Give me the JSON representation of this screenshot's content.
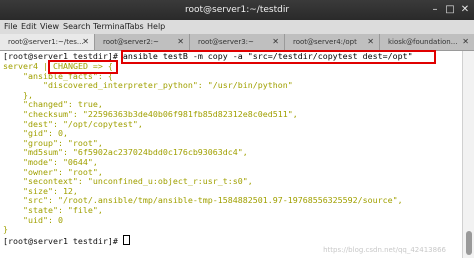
{
  "window": {
    "title": "root@server1:~/testdir",
    "menu": [
      "File",
      "Edit",
      "View",
      "Search",
      "Terminal",
      "Tabs",
      "Help"
    ],
    "tabs": [
      {
        "label": "root@server1:~/tes...",
        "active": true
      },
      {
        "label": "root@server2:~",
        "active": false
      },
      {
        "label": "root@server3:~",
        "active": false
      },
      {
        "label": "root@server4:/opt",
        "active": false
      },
      {
        "label": "kiosk@foundation...",
        "active": false
      }
    ]
  },
  "terminal": {
    "prompt1": "[root@server1 testdir]#",
    "command": "ansible testB -m copy -a \"src=/testdir/copytest dest=/opt\"",
    "host": "server4",
    "sep": "|",
    "status": "CHANGED => {",
    "output": [
      "    \"ansible_facts\": {",
      "        \"discovered_interpreter_python\": \"/usr/bin/python\"",
      "    },",
      "    \"changed\": true,",
      "    \"checksum\": \"22596363b3de40b06f981fb85d82312e8c0ed511\",",
      "    \"dest\": \"/opt/copytest\",",
      "    \"gid\": 0,",
      "    \"group\": \"root\",",
      "    \"md5sum\": \"6f5902ac237024bdd0c176cb93063dc4\",",
      "    \"mode\": \"0644\",",
      "    \"owner\": \"root\",",
      "    \"secontext\": \"unconfined_u:object_r:usr_t:s0\",",
      "    \"size\": 12,",
      "    \"src\": \"/root/.ansible/tmp/ansible-tmp-1584882501.97-19768556325592/source\",",
      "    \"state\": \"file\",",
      "    \"uid\": 0",
      "}"
    ],
    "prompt2": "[root@server1 testdir]#"
  },
  "watermark": "https://blog.csdn.net/qq_42413866"
}
